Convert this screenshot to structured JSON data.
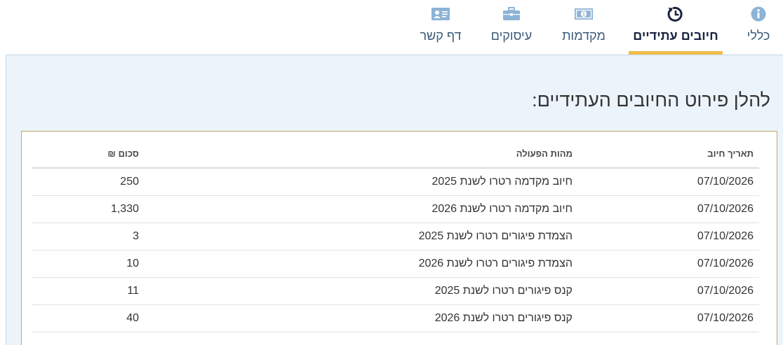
{
  "tabs": [
    {
      "id": "general",
      "label": "כללי",
      "icon": "info-icon",
      "active": false
    },
    {
      "id": "future",
      "label": "חיובים עתידיים",
      "icon": "clock-history-icon",
      "active": true
    },
    {
      "id": "advances",
      "label": "מקדמות",
      "icon": "money-icon",
      "active": false
    },
    {
      "id": "businesses",
      "label": "עיסוקים",
      "icon": "briefcase-icon",
      "active": false
    },
    {
      "id": "contact",
      "label": "דף קשר",
      "icon": "contact-card-icon",
      "active": false
    }
  ],
  "colors": {
    "accent": "#f1bd4a",
    "icon": "#8db3d6",
    "active_icon": "#1a2340",
    "panel_bg": "#ecf4fb",
    "card_border": "#c8a46a"
  },
  "main": {
    "heading": "להלן פירוט החיובים העתידיים:",
    "table": {
      "headers": {
        "date": "תאריך חיוב",
        "description": "מהות הפעולה",
        "amount": "סכום ₪"
      },
      "rows": [
        {
          "date": "07/10/2026",
          "description": "חיוב מקדמה רטרו לשנת 2025",
          "amount": "250"
        },
        {
          "date": "07/10/2026",
          "description": "חיוב מקדמה רטרו לשנת 2026",
          "amount": "1,330"
        },
        {
          "date": "07/10/2026",
          "description": "הצמדת פיגורים רטרו לשנת 2025",
          "amount": "3"
        },
        {
          "date": "07/10/2026",
          "description": "הצמדת פיגורים רטרו לשנת 2026",
          "amount": "10"
        },
        {
          "date": "07/10/2026",
          "description": "קנס פיגורים רטרו לשנת 2025",
          "amount": "11"
        },
        {
          "date": "07/10/2026",
          "description": "קנס פיגורים רטרו לשנת 2026",
          "amount": "40"
        }
      ]
    }
  }
}
